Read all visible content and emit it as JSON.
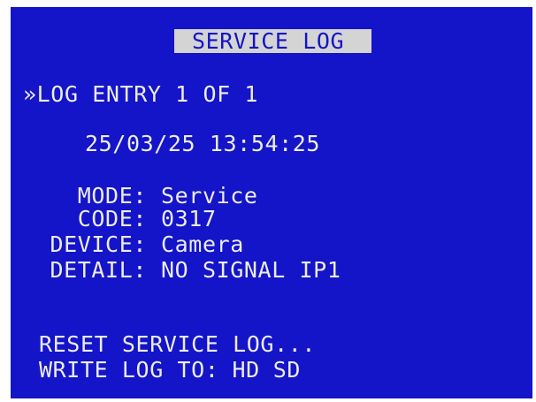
{
  "screen": {
    "title": "SERVICE LOG",
    "cursor": "»",
    "entry_label": "LOG ENTRY 1 OF 1",
    "timestamp": "25/03/25 13:54:25",
    "fields": [
      {
        "label": "MODE:",
        "value": "Service"
      },
      {
        "label": "CODE:",
        "value": "0317"
      },
      {
        "label": "DEVICE:",
        "value": "Camera"
      },
      {
        "label": "DETAIL:",
        "value": "NO SIGNAL IP1"
      }
    ],
    "reset_label": "RESET SERVICE LOG...",
    "write_log_label": "WRITE LOG TO:",
    "write_log_options": [
      "HD",
      "SD"
    ]
  },
  "colors": {
    "background": "#1414c8",
    "text": "#ececec",
    "title_highlight": "#d4d4d4"
  }
}
